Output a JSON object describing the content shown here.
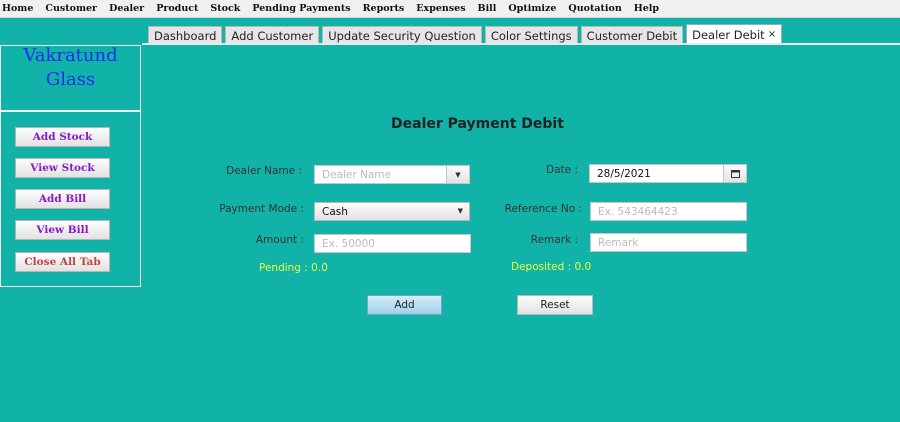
{
  "menu": [
    "Home",
    "Customer",
    "Dealer",
    "Product",
    "Stock",
    "Pending Payments",
    "Reports",
    "Expenses",
    "Bill",
    "Optimize",
    "Quotation",
    "Help"
  ],
  "tabs": [
    {
      "label": "Dashboard"
    },
    {
      "label": "Add Customer"
    },
    {
      "label": "Update Security Question"
    },
    {
      "label": "Color Settings"
    },
    {
      "label": "Customer Debit"
    },
    {
      "label": "Dealer Debit",
      "close": "×",
      "active": true
    }
  ],
  "brand": {
    "line1": "Vakratund",
    "line2": "Glass"
  },
  "sidebar": {
    "add_stock": "Add Stock",
    "view_stock": "View Stock",
    "add_bill": "Add Bill",
    "view_bill": "View Bill",
    "close_all": "Close All Tab"
  },
  "form": {
    "title": "Dealer Payment Debit",
    "dealer_name_label": "Dealer Name :",
    "dealer_name_placeholder": "Dealer Name",
    "date_label": "Date :",
    "date_value": "28/5/2021",
    "payment_mode_label": "Payment Mode :",
    "payment_mode_value": "Cash",
    "reference_label": "Reference No :",
    "reference_placeholder": "Ex. 543464423",
    "amount_label": "Amount :",
    "amount_placeholder": "Ex. 50000",
    "remark_label": "Remark :",
    "remark_placeholder": "Remark",
    "pending": "Pending : 0.0",
    "deposited": "Deposited : 0.0",
    "add_label": "Add",
    "reset_label": "Reset"
  },
  "icons": {
    "dropdown": "chevron-down-icon",
    "calendar": "calendar-icon"
  },
  "colors": {
    "background": "#11b2a7",
    "brand": "#1f2df0",
    "sidebar_button_text": "#8a18c8",
    "status_text": "#e8ff3a"
  }
}
